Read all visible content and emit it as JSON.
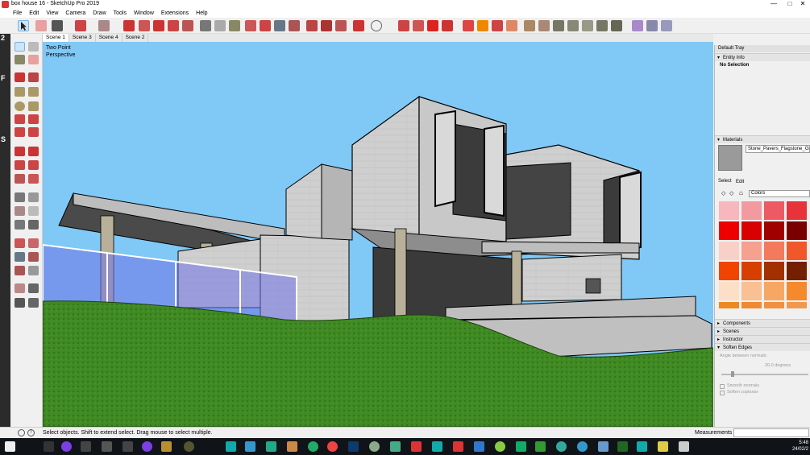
{
  "window": {
    "title": "box house 16 - SketchUp Pro 2019",
    "controls": [
      "—",
      "□",
      "✕"
    ]
  },
  "menu": [
    "File",
    "Edit",
    "View",
    "Camera",
    "Draw",
    "Tools",
    "Window",
    "Extensions",
    "Help"
  ],
  "scene_tabs": [
    "Scene 1",
    "Scene 3",
    "Scene 4",
    "Scene 2"
  ],
  "active_scene": "Scene 1",
  "viewport": {
    "perspective_line1": "Two Point",
    "perspective_line2": "Perspective",
    "sky_color": "#80c8f5",
    "grass_color": "#3f8a22"
  },
  "left_strip_labels": [
    "2",
    "F",
    "S"
  ],
  "tray": {
    "title": "Default Tray",
    "entity_info": {
      "header": "Entity Info",
      "value": "No Selection"
    },
    "materials": {
      "header": "Materials",
      "current_material": "Stone_Pavers_Flagstone_Gr",
      "tab_select": "Select",
      "tab_edit": "Edit",
      "library": "Colors",
      "swatches": [
        "#f7b7bd",
        "#f39aa1",
        "#ee5a64",
        "#e8333a",
        "#ee0000",
        "#d80000",
        "#a00000",
        "#7a0000",
        "#f9d0c8",
        "#f6a08f",
        "#f47a5e",
        "#f0582b",
        "#f04400",
        "#d63f00",
        "#a33000",
        "#742000",
        "#fcdfc6",
        "#f9c093",
        "#f6a763",
        "#f48a2c",
        "#f08820",
        "#f08a30",
        "#f09040",
        "#f09850"
      ]
    },
    "collapsed_panels": [
      "Components",
      "Scenes",
      "Instructor"
    ],
    "soften_edges": {
      "header": "Soften Edges",
      "angle_label": "Angle between normals:",
      "angle_value": "20.0  degrees",
      "smooth_normals": "Smooth normals",
      "soften_coplanar": "Soften coplanar"
    }
  },
  "status": {
    "message": "Select objects. Shift to extend select. Drag mouse to select multiple.",
    "measurements_label": "Measurements"
  },
  "taskbar": {
    "time": "5:48",
    "date": "24/02/2"
  }
}
